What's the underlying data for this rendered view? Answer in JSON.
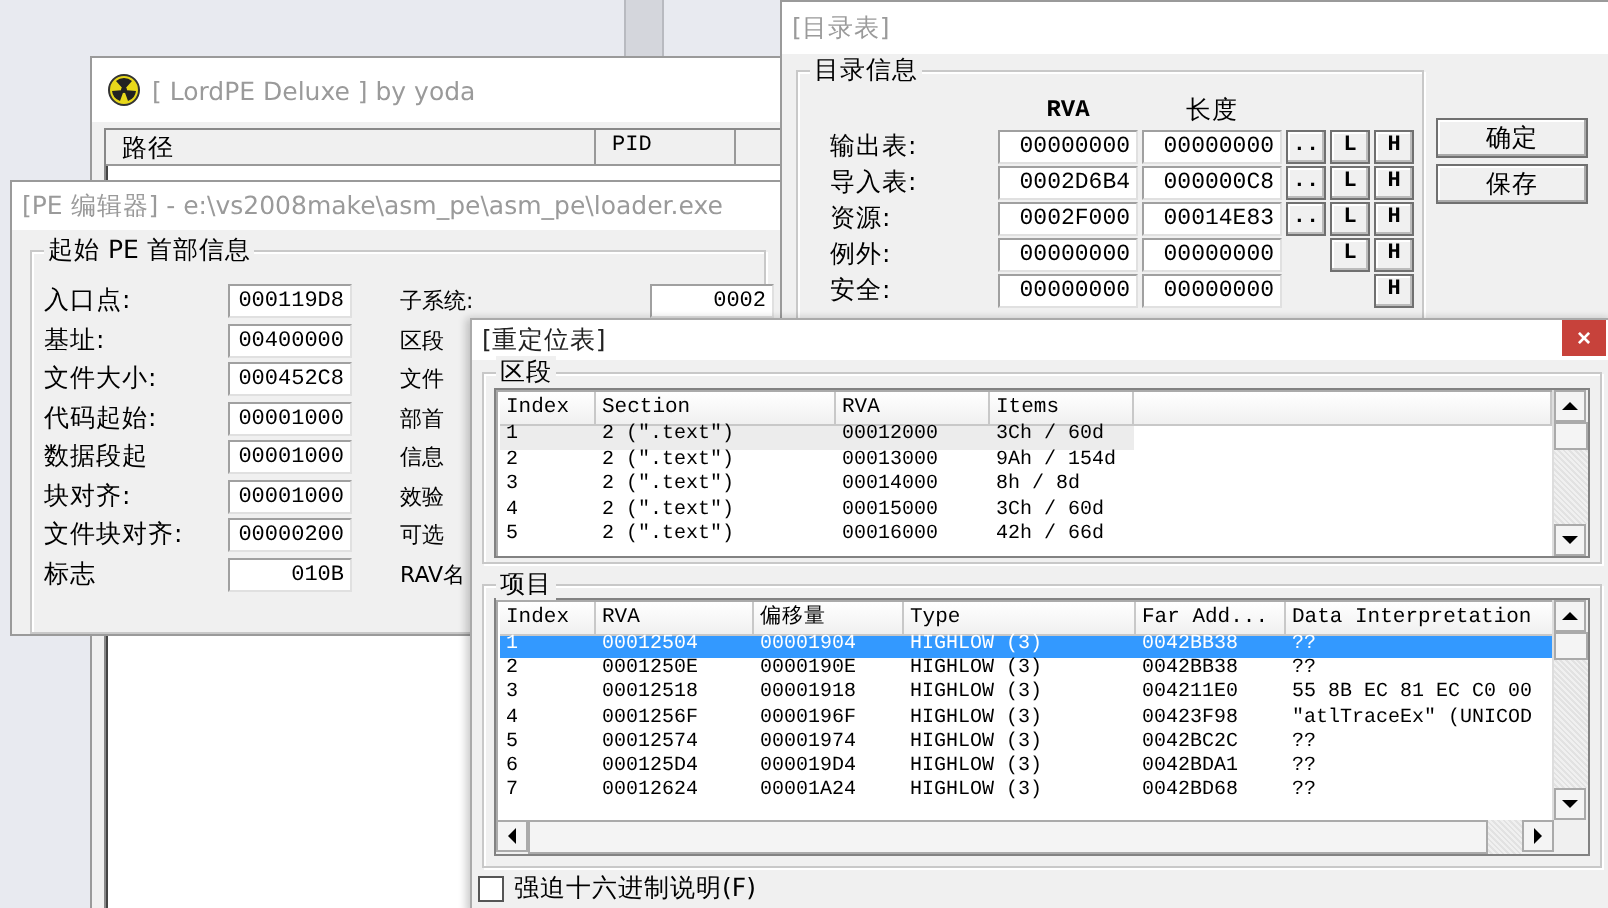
{
  "lordpe_window": {
    "title": "[ LordPE Deluxe ] by yoda",
    "columns": [
      "路径",
      "PID"
    ]
  },
  "pe_editor": {
    "title": "[PE 编辑器] - e:\\vs2008make\\asm_pe\\asm_pe\\loader.exe",
    "group": "起始 PE 首部信息",
    "fields": [
      {
        "label": "入口点:",
        "value": "000119D8"
      },
      {
        "label": "基址:",
        "value": "00400000"
      },
      {
        "label": "文件大小:",
        "value": "000452C8"
      },
      {
        "label": "代码起始:",
        "value": "00001000"
      },
      {
        "label": "数据段起",
        "value": "00001000"
      },
      {
        "label": "块对齐:",
        "value": "00001000"
      },
      {
        "label": "文件块对齐:",
        "value": "00000200"
      },
      {
        "label": "标志",
        "value": "010B"
      }
    ],
    "right_labels": [
      "子系统:",
      "区段",
      "文件",
      "部首",
      "信息",
      "效验",
      "可选",
      "RAV名"
    ],
    "right_value": "0002"
  },
  "directory_window": {
    "title": "[目录表]",
    "group": "目录信息",
    "columns": [
      "RVA",
      "长度"
    ],
    "rows": [
      {
        "label": "输出表:",
        "rva": "00000000",
        "size": "00000000",
        "buttons": [
          "..",
          "L",
          "H"
        ]
      },
      {
        "label": "导入表:",
        "rva": "0002D6B4",
        "size": "000000C8",
        "buttons": [
          "..",
          "L",
          "H"
        ]
      },
      {
        "label": "资源:",
        "rva": "0002F000",
        "size": "00014E83",
        "buttons": [
          "..",
          "L",
          "H"
        ]
      },
      {
        "label": "例外:",
        "rva": "00000000",
        "size": "00000000",
        "buttons": [
          "L",
          "H"
        ]
      },
      {
        "label": "安全:",
        "rva": "00000000",
        "size": "00000000",
        "buttons": [
          "H"
        ]
      }
    ],
    "buttons": [
      "确定",
      "保存"
    ]
  },
  "relocation_window": {
    "title": "[重定位表]",
    "close": "×",
    "sections": {
      "title": "区段",
      "columns": [
        "Index",
        "Section",
        "RVA",
        "Items"
      ],
      "rows": [
        {
          "cells": [
            "1",
            "2 (\".text\")",
            "00012000",
            "3Ch / 60d"
          ],
          "selected": true
        },
        {
          "cells": [
            "2",
            "2 (\".text\")",
            "00013000",
            "9Ah / 154d"
          ],
          "selected": false
        },
        {
          "cells": [
            "3",
            "2 (\".text\")",
            "00014000",
            "8h / 8d"
          ],
          "selected": false
        },
        {
          "cells": [
            "4",
            "2 (\".text\")",
            "00015000",
            "3Ch / 60d"
          ],
          "selected": false
        },
        {
          "cells": [
            "5",
            "2 (\".text\")",
            "00016000",
            "42h / 66d"
          ],
          "selected": false
        }
      ]
    },
    "items": {
      "title": "项目",
      "columns": [
        "Index",
        "RVA",
        "偏移量",
        "Type",
        "Far Add...",
        "Data Interpretation"
      ],
      "rows": [
        {
          "cells": [
            "1",
            "00012504",
            "00001904",
            "HIGHLOW (3)",
            "0042BB38",
            "??"
          ],
          "selected": true
        },
        {
          "cells": [
            "2",
            "0001250E",
            "0000190E",
            "HIGHLOW (3)",
            "0042BB38",
            "??"
          ],
          "selected": false
        },
        {
          "cells": [
            "3",
            "00012518",
            "00001918",
            "HIGHLOW (3)",
            "004211E0",
            "55 8B EC 81 EC C0 00"
          ],
          "selected": false
        },
        {
          "cells": [
            "4",
            "0001256F",
            "0000196F",
            "HIGHLOW (3)",
            "00423F98",
            "\"atlTraceEx\" (UNICOD"
          ],
          "selected": false
        },
        {
          "cells": [
            "5",
            "00012574",
            "00001974",
            "HIGHLOW (3)",
            "0042BC2C",
            "??"
          ],
          "selected": false
        },
        {
          "cells": [
            "6",
            "000125D4",
            "000019D4",
            "HIGHLOW (3)",
            "0042BDA1",
            "??"
          ],
          "selected": false
        },
        {
          "cells": [
            "7",
            "00012624",
            "00001A24",
            "HIGHLOW (3)",
            "0042BD68",
            "??"
          ],
          "selected": false
        }
      ]
    },
    "checkbox": {
      "label": "强迫十六进制说明(F)",
      "checked": false
    }
  }
}
